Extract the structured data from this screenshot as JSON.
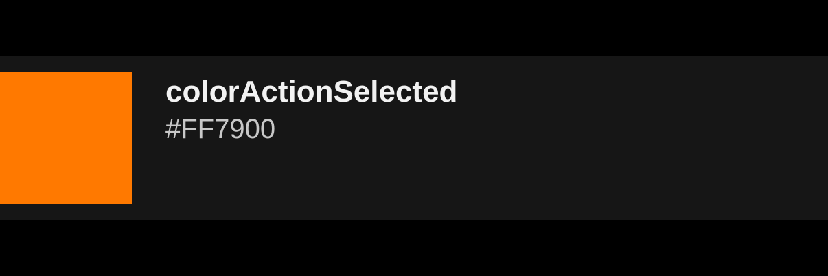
{
  "color_item": {
    "name": "colorActionSelected",
    "hex": "#FF7900",
    "swatch_color": "#FF7900"
  }
}
